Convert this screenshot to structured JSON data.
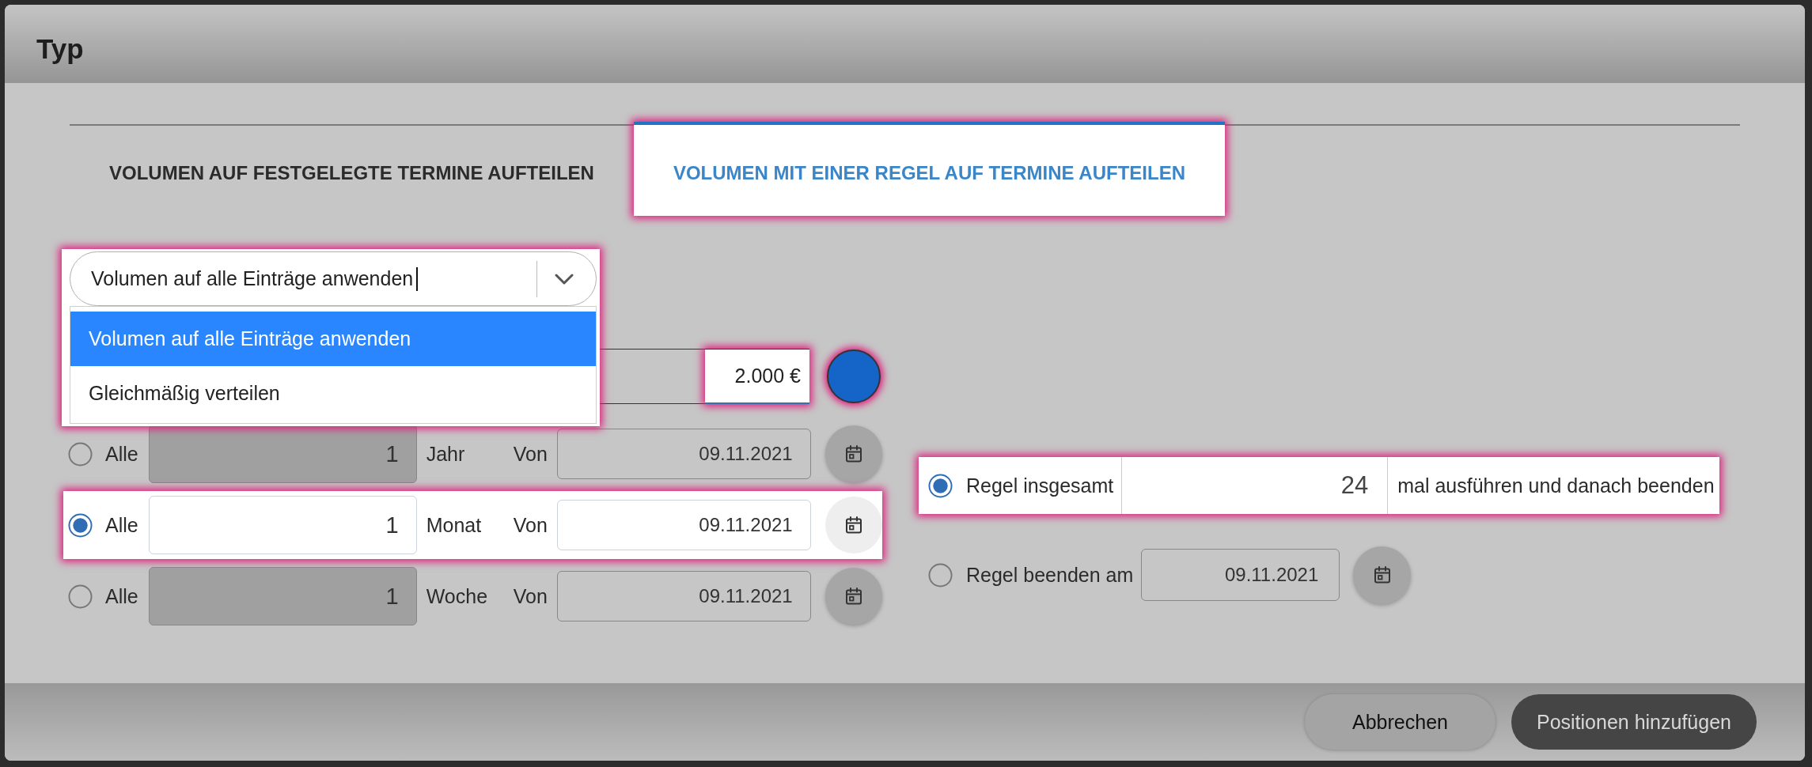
{
  "dialog": {
    "title": "Typ"
  },
  "tabs": [
    {
      "label": "VOLUMEN AUF FESTGELEGTE TERMINE AUFTEILEN",
      "selected": false,
      "highlighted": false
    },
    {
      "label": "VOLUMEN MIT EINER REGEL AUF TERMINE AUFTEILEN",
      "selected": true,
      "highlighted": true
    }
  ],
  "dropdown": {
    "value": "Volumen auf alle Einträge anwenden",
    "focused": true,
    "expanded": true,
    "highlighted": true,
    "options": [
      {
        "label": "Volumen auf alle Einträge anwenden",
        "selected": true
      },
      {
        "label": "Gleichmäßig verteilen",
        "selected": false
      }
    ]
  },
  "amount": {
    "value": "2.000 €",
    "highlighted": true
  },
  "color_swatch": {
    "color": "#1565c8",
    "highlighted": true
  },
  "recurrence": [
    {
      "label": "Alle",
      "count": "1",
      "unit": "Jahr",
      "from_label": "Von",
      "date": "09.11.2021",
      "selected": false,
      "highlighted": false
    },
    {
      "label": "Alle",
      "count": "1",
      "unit": "Monat",
      "from_label": "Von",
      "date": "09.11.2021",
      "selected": true,
      "highlighted": true
    },
    {
      "label": "Alle",
      "count": "1",
      "unit": "Woche",
      "from_label": "Von",
      "date": "09.11.2021",
      "selected": false,
      "highlighted": false
    }
  ],
  "end_rules": [
    {
      "kind": "count",
      "label": "Regel insgesamt",
      "value": "24",
      "suffix": "mal ausführen und danach beenden",
      "selected": true,
      "highlighted": true
    },
    {
      "kind": "date",
      "label": "Regel beenden am",
      "date": "09.11.2021",
      "selected": false,
      "highlighted": false
    }
  ],
  "footer": {
    "buttons": [
      {
        "label": "Abbrechen",
        "kind": "secondary"
      },
      {
        "label": "Positionen hinzufügen",
        "kind": "primary"
      }
    ]
  }
}
